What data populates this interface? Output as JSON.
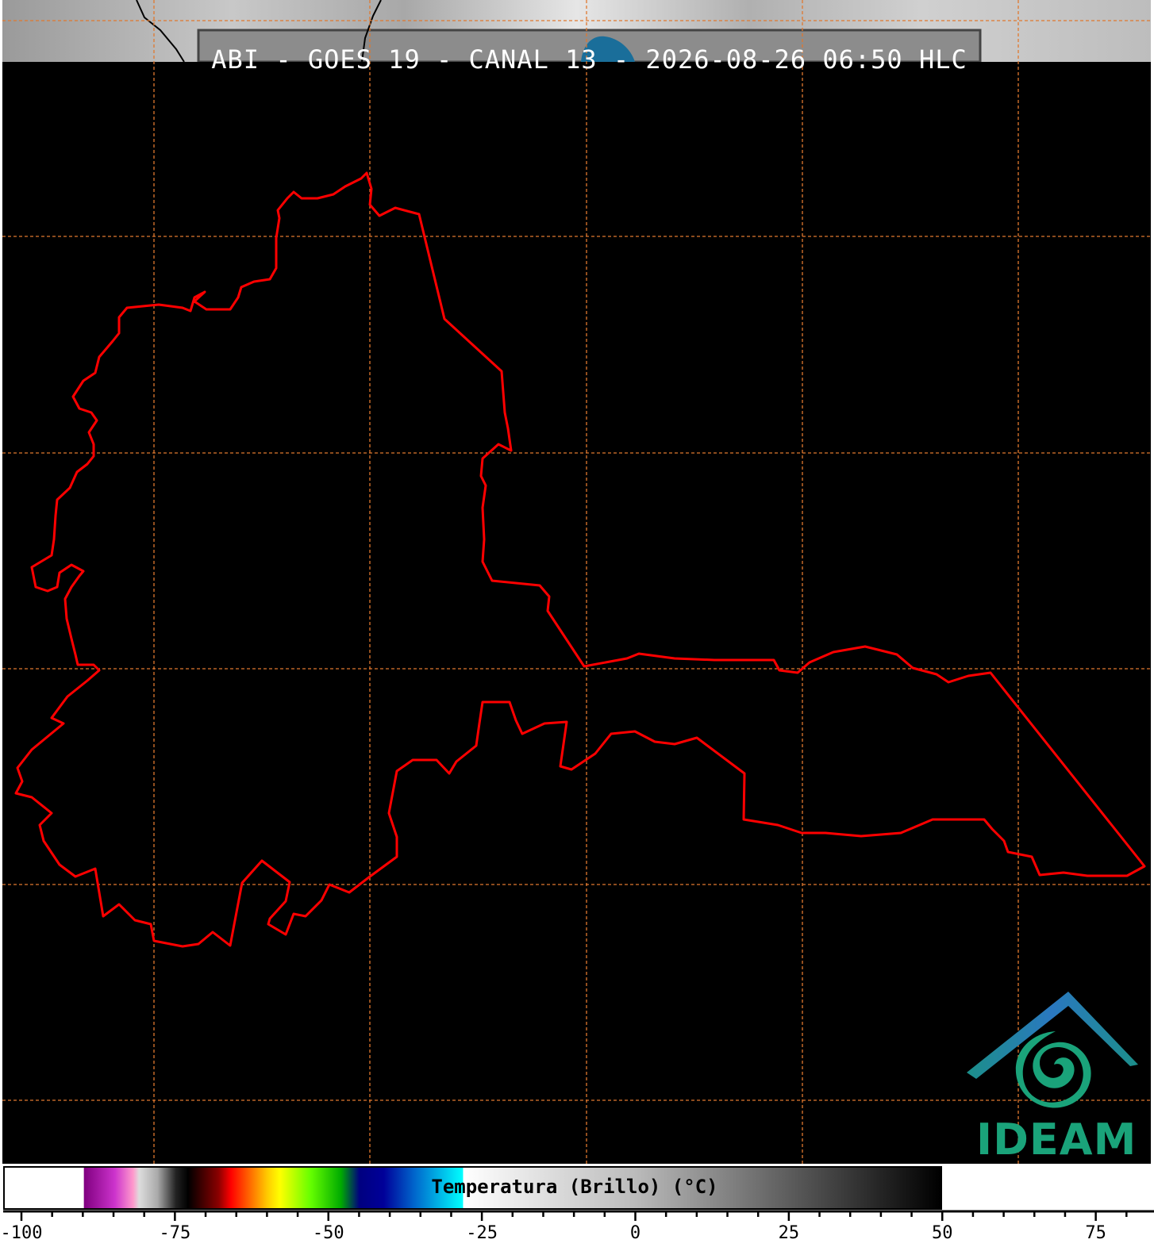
{
  "title": "ABI - GOES 19 - CANAL 13 - 2026-08-26 06:50 HLC",
  "logo": {
    "text": "IDEAM",
    "color": "#1aa37a"
  },
  "colorbar": {
    "label": "Temperatura (Brillo) (°C)",
    "min": -100,
    "max": 50,
    "axis_max": 85,
    "tick_labels": [
      "-100",
      "-75",
      "-50",
      "-25",
      "0",
      "25",
      "50",
      "75"
    ],
    "tick_values": [
      -100,
      -75,
      -50,
      -25,
      0,
      25,
      50,
      75
    ],
    "stops": [
      {
        "t": -100,
        "color": "#ffffff"
      },
      {
        "t": -90.1,
        "color": "#ffffff"
      },
      {
        "t": -90,
        "color": "#800080"
      },
      {
        "t": -85,
        "color": "#cc33cc"
      },
      {
        "t": -82,
        "color": "#ff99cc"
      },
      {
        "t": -81,
        "color": "#dddddd"
      },
      {
        "t": -78,
        "color": "#aaaaaa"
      },
      {
        "t": -75,
        "color": "#222222"
      },
      {
        "t": -73,
        "color": "#000000"
      },
      {
        "t": -68,
        "color": "#8b0000"
      },
      {
        "t": -66,
        "color": "#ff0000"
      },
      {
        "t": -63,
        "color": "#ff6600"
      },
      {
        "t": -60,
        "color": "#ffcc00"
      },
      {
        "t": -58,
        "color": "#ffff00"
      },
      {
        "t": -53,
        "color": "#66ff00"
      },
      {
        "t": -48,
        "color": "#00aa00"
      },
      {
        "t": -45,
        "color": "#000080"
      },
      {
        "t": -41,
        "color": "#000099"
      },
      {
        "t": -36,
        "color": "#0066cc"
      },
      {
        "t": -28.1,
        "color": "#00ffff"
      },
      {
        "t": -28,
        "color": "#ffffff"
      },
      {
        "t": 0,
        "color": "#bbbbbb"
      },
      {
        "t": 50,
        "color": "#000000"
      }
    ]
  },
  "map": {
    "background": "#000000",
    "boundary_color": "#ff0000",
    "grid_color": "#e0782f",
    "border_color": "#000000"
  }
}
